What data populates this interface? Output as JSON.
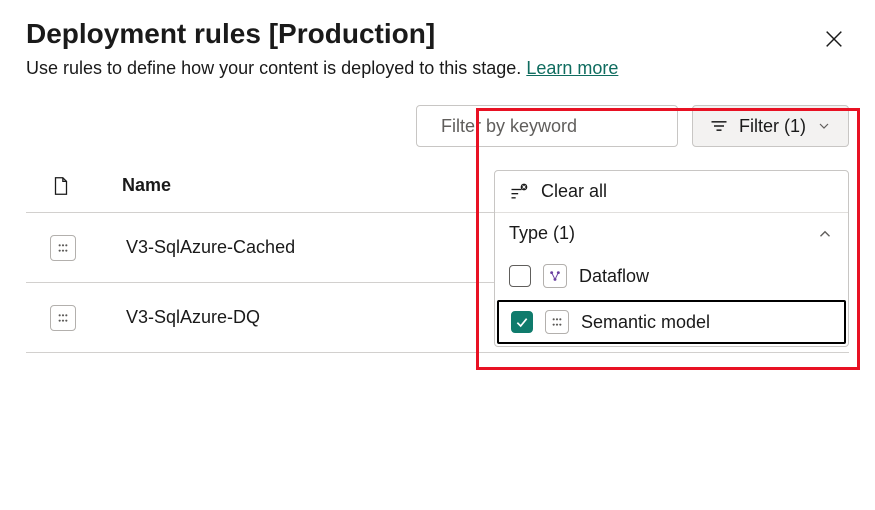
{
  "header": {
    "title": "Deployment rules [Production]",
    "subtitle_text": "Use rules to define how your content is deployed to this stage.",
    "learn_more": "Learn more"
  },
  "toolbar": {
    "search_placeholder": "Filter by keyword",
    "filter_button": "Filter (1)"
  },
  "table": {
    "name_header": "Name",
    "rows": [
      {
        "name": "V3-SqlAzure-Cached"
      },
      {
        "name": "V3-SqlAzure-DQ"
      }
    ]
  },
  "filter_panel": {
    "clear_all": "Clear all",
    "type_header": "Type (1)",
    "options": [
      {
        "label": "Dataflow",
        "checked": false,
        "icon": "dataflow"
      },
      {
        "label": "Semantic model",
        "checked": true,
        "icon": "semantic-model"
      }
    ]
  },
  "colors": {
    "accent": "#0f7b6c",
    "annotation": "#e81123"
  }
}
